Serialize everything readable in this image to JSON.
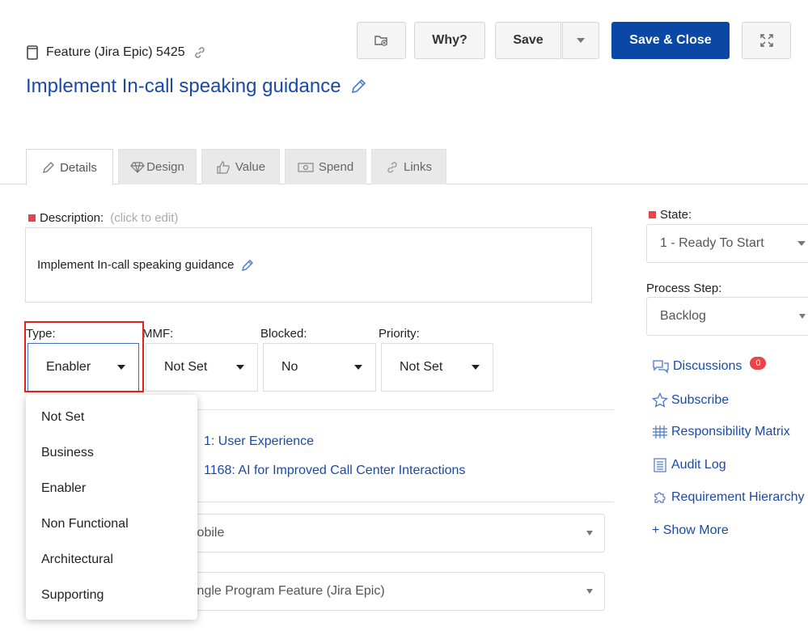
{
  "header": {
    "item_kind": "Feature (Jira Epic) 5425",
    "title": "Implement In-call speaking guidance"
  },
  "toolbar": {
    "why_label": "Why?",
    "save_label": "Save",
    "save_close_label": "Save & Close"
  },
  "tabs": [
    {
      "label": "Details",
      "icon": "pencil-icon",
      "active": true
    },
    {
      "label": "Design",
      "icon": "diamond-icon"
    },
    {
      "label": "Value",
      "icon": "thumbs-up-icon"
    },
    {
      "label": "Spend",
      "icon": "money-icon"
    },
    {
      "label": "Links",
      "icon": "link-icon"
    }
  ],
  "description": {
    "label": "Description:",
    "hint": "(click to edit)",
    "value": "Implement In-call speaking guidance"
  },
  "fields": {
    "type": {
      "label": "Type:",
      "value": "Enabler"
    },
    "mmf": {
      "label": "MMF:",
      "value": "Not Set"
    },
    "blocked": {
      "label": "Blocked:",
      "value": "No"
    },
    "priority": {
      "label": "Priority:",
      "value": "Not Set"
    }
  },
  "type_options": [
    "Not Set",
    "Business",
    "Enabler",
    "Non Functional",
    "Architectural",
    "Supporting"
  ],
  "links": {
    "parent1": "1: User Experience",
    "parent2": "1168: AI for Improved Call Center Interactions"
  },
  "partial_selects": {
    "product": "lobile",
    "item_type": "ingle Program Feature (Jira Epic)"
  },
  "sidebar": {
    "state_label": "State:",
    "state_value": "1 - Ready To Start",
    "process_step_label": "Process Step:",
    "process_step_value": "Backlog",
    "discussions_label": "Discussions",
    "discussions_count": "0",
    "subscribe_label": "Subscribe",
    "responsibility_label": "Responsibility Matrix",
    "audit_label": "Audit Log",
    "hierarchy_label": "Requirement Hierarchy",
    "show_more_label": "+ Show More"
  },
  "colors": {
    "primary": "#0b48a6",
    "link": "#1a4aa8",
    "required": "#e8454a",
    "highlight": "#e1251b"
  }
}
